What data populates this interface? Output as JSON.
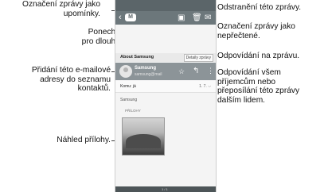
{
  "callouts": {
    "flag": "Označení zprávy jako\nupomínky.",
    "save": "Ponechání této zprávy\npro dlouhodobé uložení.",
    "add_contact": "Přidání této e-mailové\nadresy do seznamu\nkontaktů.",
    "preview": "Náhled přílohy.",
    "delete": "Odstranění této zprávy.",
    "unread": "Označení zprávy jako\nnepřečtené.",
    "reply": "Odpovídání na zprávu.",
    "reply_all": "Odpovídání všem\npříjemcům nebo\npřeposílání této zprávy\ndalším lidem."
  },
  "phone": {
    "back": "‹",
    "logo": "M",
    "subject": "About Samsung",
    "detail_button": "Detaily zprávy",
    "sender_name": "Samsung",
    "sender_email": "samsung@mail",
    "star": "☆",
    "reply": "↰",
    "more": "⋮",
    "to_label": "Komu: já",
    "date": "1. 7. ⌵",
    "body_text": "Samsung",
    "attachments_label": "PŘÍLOHY",
    "bottom_left": "",
    "bottom_mid": "1 / 1",
    "bottom_right": "",
    "icons": {
      "save": "▣",
      "delete": "🗑",
      "unread": "✉"
    }
  }
}
